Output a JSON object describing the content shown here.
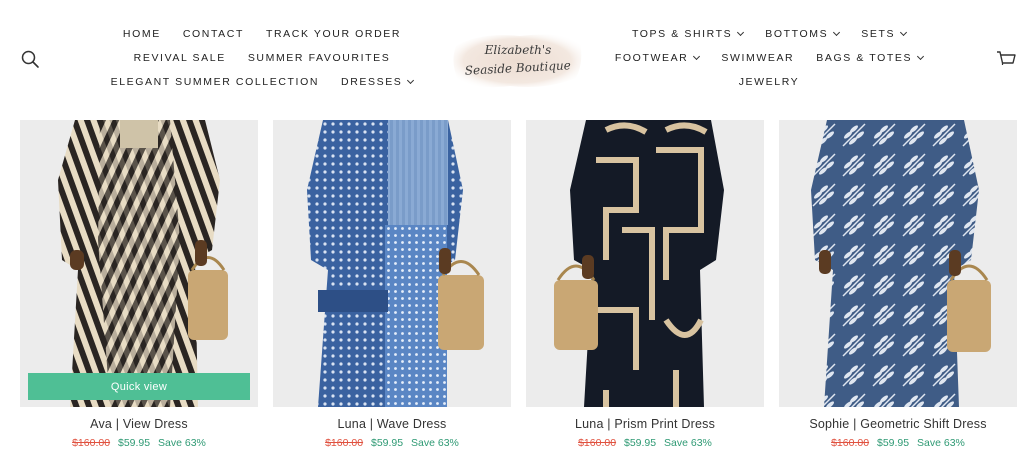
{
  "header": {
    "nav_left": {
      "row1": [
        {
          "label": "HOME",
          "dropdown": false
        },
        {
          "label": "CONTACT",
          "dropdown": false
        },
        {
          "label": "TRACK YOUR ORDER",
          "dropdown": false
        }
      ],
      "row2": [
        {
          "label": "REVIVAL SALE",
          "dropdown": false
        },
        {
          "label": "SUMMER FAVOURITES",
          "dropdown": false
        }
      ],
      "row3": [
        {
          "label": "ELEGANT SUMMER COLLECTION",
          "dropdown": false
        },
        {
          "label": "DRESSES",
          "dropdown": true
        }
      ]
    },
    "nav_right": {
      "row1": [
        {
          "label": "TOPS & SHIRTS",
          "dropdown": true
        },
        {
          "label": "BOTTOMS",
          "dropdown": true
        },
        {
          "label": "SETS",
          "dropdown": true
        }
      ],
      "row2": [
        {
          "label": "FOOTWEAR",
          "dropdown": true
        },
        {
          "label": "SWIMWEAR",
          "dropdown": false
        },
        {
          "label": "BAGS & TOTES",
          "dropdown": true
        }
      ],
      "row3": [
        {
          "label": "JEWELRY",
          "dropdown": false
        }
      ]
    },
    "logo": {
      "line1": "Elizabeth's",
      "line2": "Seaside Boutique"
    },
    "icons": {
      "search": "search-icon",
      "cart": "cart-icon"
    }
  },
  "products": [
    {
      "title": "Ava | View Dress",
      "price_old": "$160.00",
      "price_new": "$59.95",
      "save": "Save 63%",
      "quick_view": "Quick view",
      "pattern": "zebra-swirl"
    },
    {
      "title": "Luna | Wave Dress",
      "price_old": "$160.00",
      "price_new": "$59.95",
      "save": "Save 63%",
      "pattern": "blue-patchwork"
    },
    {
      "title": "Luna | Prism Print Dress",
      "price_old": "$160.00",
      "price_new": "$59.95",
      "save": "Save 63%",
      "pattern": "black-tan-geometric"
    },
    {
      "title": "Sophie | Geometric Shift Dress",
      "price_old": "$160.00",
      "price_new": "$59.95",
      "save": "Save 63%",
      "pattern": "blue-leaf"
    }
  ],
  "colors": {
    "accent_green": "#4fbf95",
    "price_old_red": "#e0513f",
    "price_new_green": "#2f9a74",
    "image_bg": "#ececec"
  }
}
